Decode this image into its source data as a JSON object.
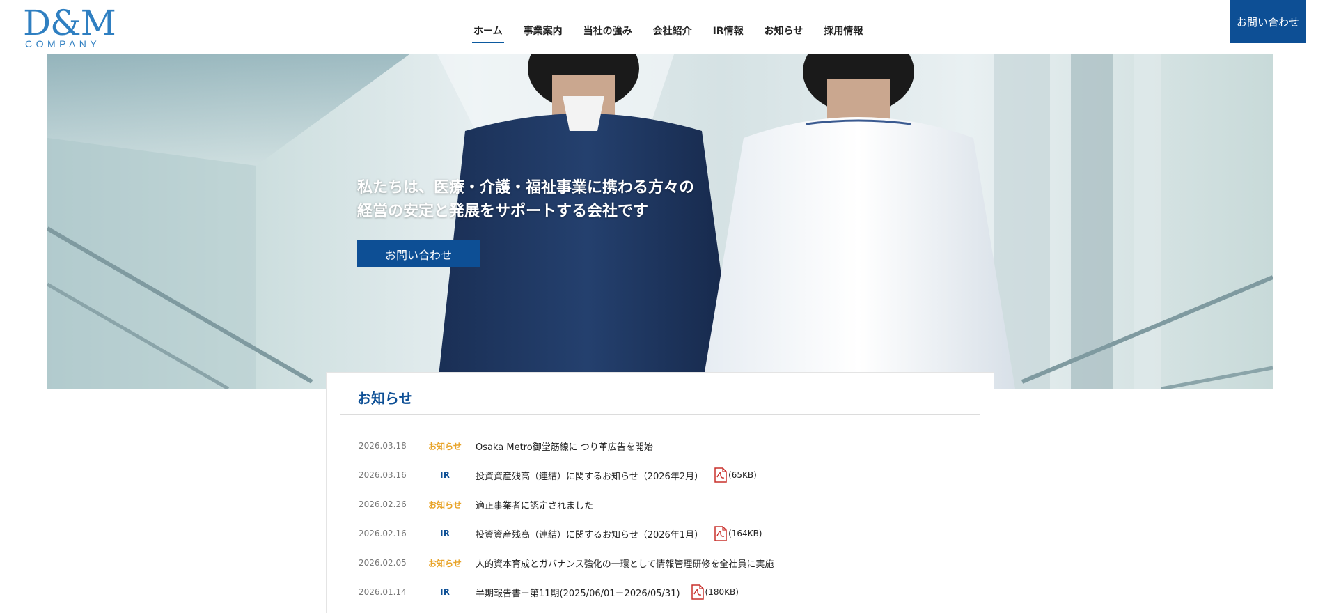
{
  "header": {
    "logo_main": "D&M",
    "logo_sub": "COMPANY",
    "nav": [
      {
        "label": "ホーム",
        "active": true
      },
      {
        "label": "事業案内"
      },
      {
        "label": "当社の強み"
      },
      {
        "label": "会社紹介"
      },
      {
        "label": "IR情報"
      },
      {
        "label": "お知らせ"
      },
      {
        "label": "採用情報"
      }
    ],
    "contact_label": "お問い合わせ"
  },
  "hero": {
    "line1": "私たちは、医療・介護・福祉事業に携わる方々の",
    "line2": "経営の安定と発展をサポートする会社です",
    "button_label": "お問い合わせ"
  },
  "news": {
    "title": "お知らせ",
    "items": [
      {
        "date": "2026.03.18",
        "category": "お知らせ",
        "cat_color": "orange",
        "text": "Osaka Metro御堂筋線に つり革広告を開始",
        "pdf": false,
        "size": ""
      },
      {
        "date": "2026.03.16",
        "category": "IR",
        "cat_color": "blue",
        "text": "投資資産残高（連結）に関するお知らせ（2026年2月）",
        "pdf": true,
        "size": "(65KB)"
      },
      {
        "date": "2026.02.26",
        "category": "お知らせ",
        "cat_color": "orange",
        "text": "適正事業者に認定されました",
        "pdf": false,
        "size": ""
      },
      {
        "date": "2026.02.16",
        "category": "IR",
        "cat_color": "blue",
        "text": "投資資産残高（連結）に関するお知らせ（2026年1月）",
        "pdf": true,
        "size": "(164KB)"
      },
      {
        "date": "2026.02.05",
        "category": "お知らせ",
        "cat_color": "orange",
        "text": "人的資本育成とガバナンス強化の一環として情報管理研修を全社員に実施",
        "pdf": false,
        "size": ""
      },
      {
        "date": "2026.01.14",
        "category": "IR",
        "cat_color": "blue",
        "text": "半期報告書－第11期(2025/06/01－2026/05/31)",
        "pdf": true,
        "size": "(180KB)"
      }
    ]
  },
  "colors": {
    "brand_blue": "#0d4f95",
    "logo_blue": "#2f7fc1",
    "news_orange": "#e8a42a"
  }
}
